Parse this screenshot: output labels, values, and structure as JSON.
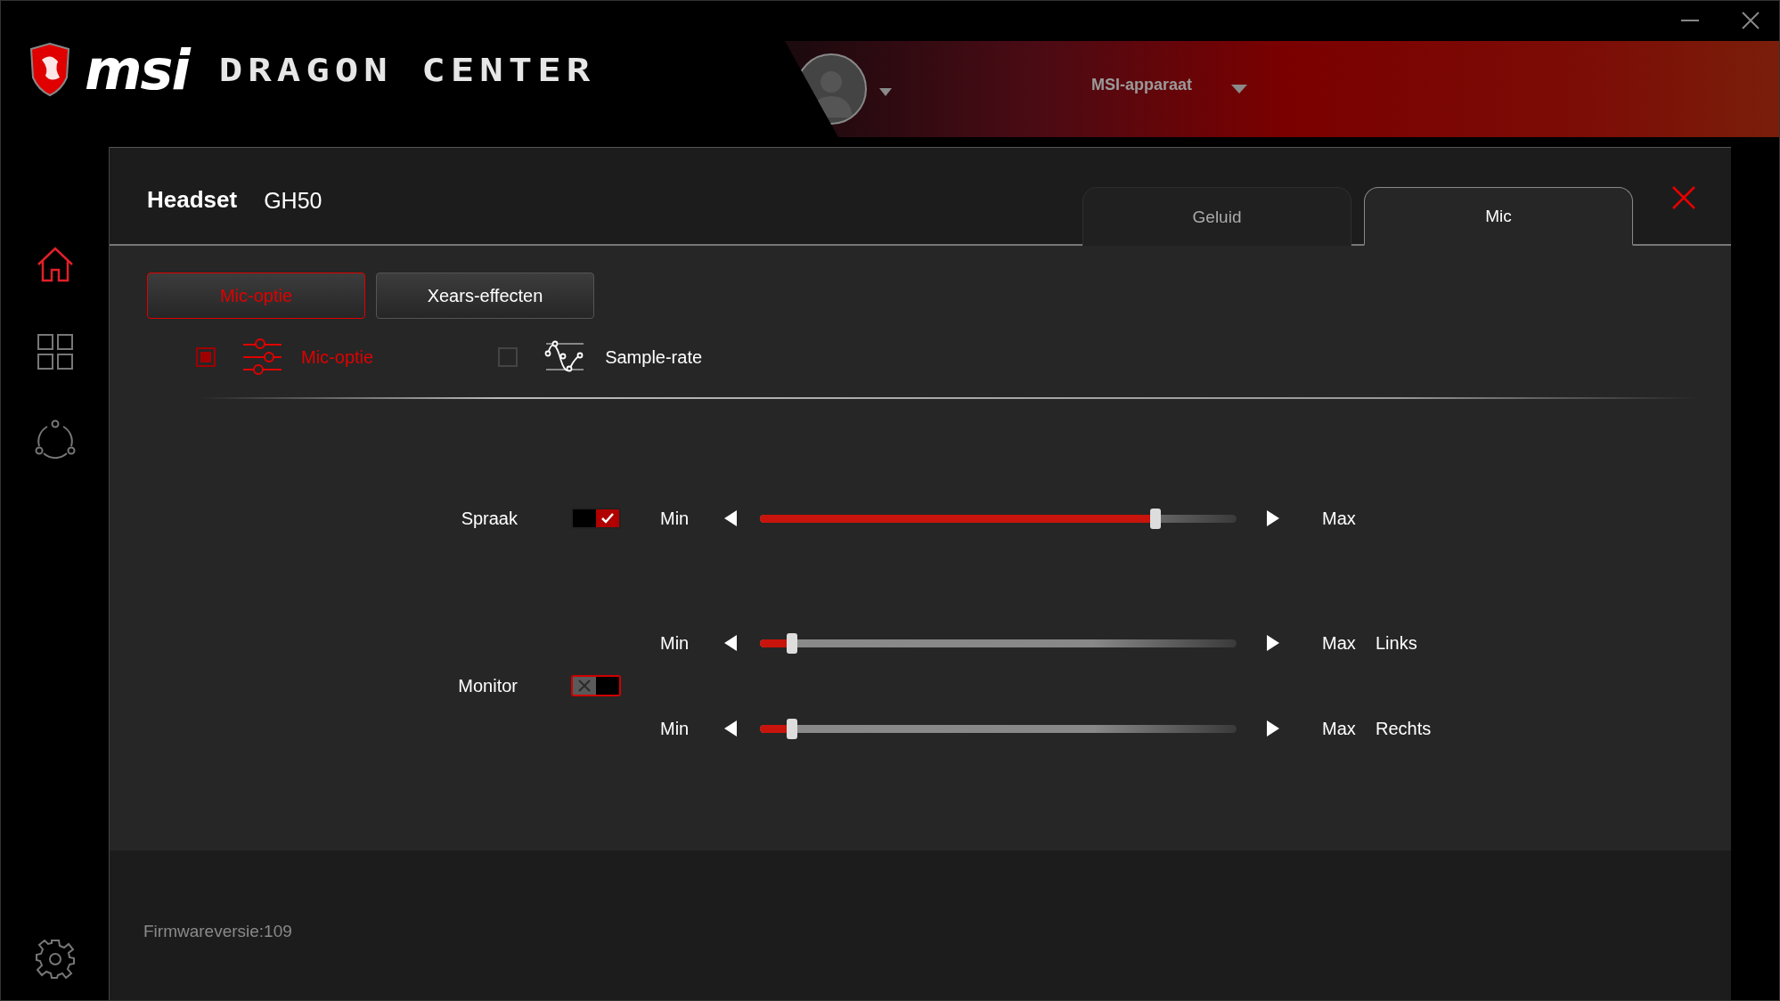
{
  "header": {
    "brand": "msi",
    "product": "DRAGON CENTER",
    "device_select": "MSI-apparaat"
  },
  "sidebar": {
    "items": [
      {
        "kind": "home",
        "selected": true
      },
      {
        "kind": "grid",
        "selected": false
      },
      {
        "kind": "network",
        "selected": false
      }
    ]
  },
  "panel": {
    "title": "Headset",
    "model": "GH50",
    "tabs": [
      {
        "label": "Geluid",
        "selected": false
      },
      {
        "label": "Mic",
        "selected": true
      }
    ],
    "subtabs": [
      {
        "label": "Mic-optie",
        "selected": true
      },
      {
        "label": "Xears-effecten",
        "selected": false
      }
    ],
    "options": [
      {
        "label": "Mic-optie",
        "kind": "sliders",
        "checked": true
      },
      {
        "label": "Sample-rate",
        "kind": "wave",
        "checked": false
      }
    ],
    "controls": [
      {
        "label": "Spraak",
        "on": true,
        "sliders": [
          {
            "min": "Min",
            "max": "Max",
            "level": 0.83
          }
        ]
      },
      {
        "label": "Monitor",
        "on": false,
        "sliders": [
          {
            "min": "Min",
            "max": "Max",
            "side": "Links",
            "level": 0.067
          },
          {
            "min": "Min",
            "max": "Max",
            "side": "Rechts",
            "level": 0.067
          }
        ]
      }
    ],
    "firmware": "Firmwareversie:109"
  }
}
